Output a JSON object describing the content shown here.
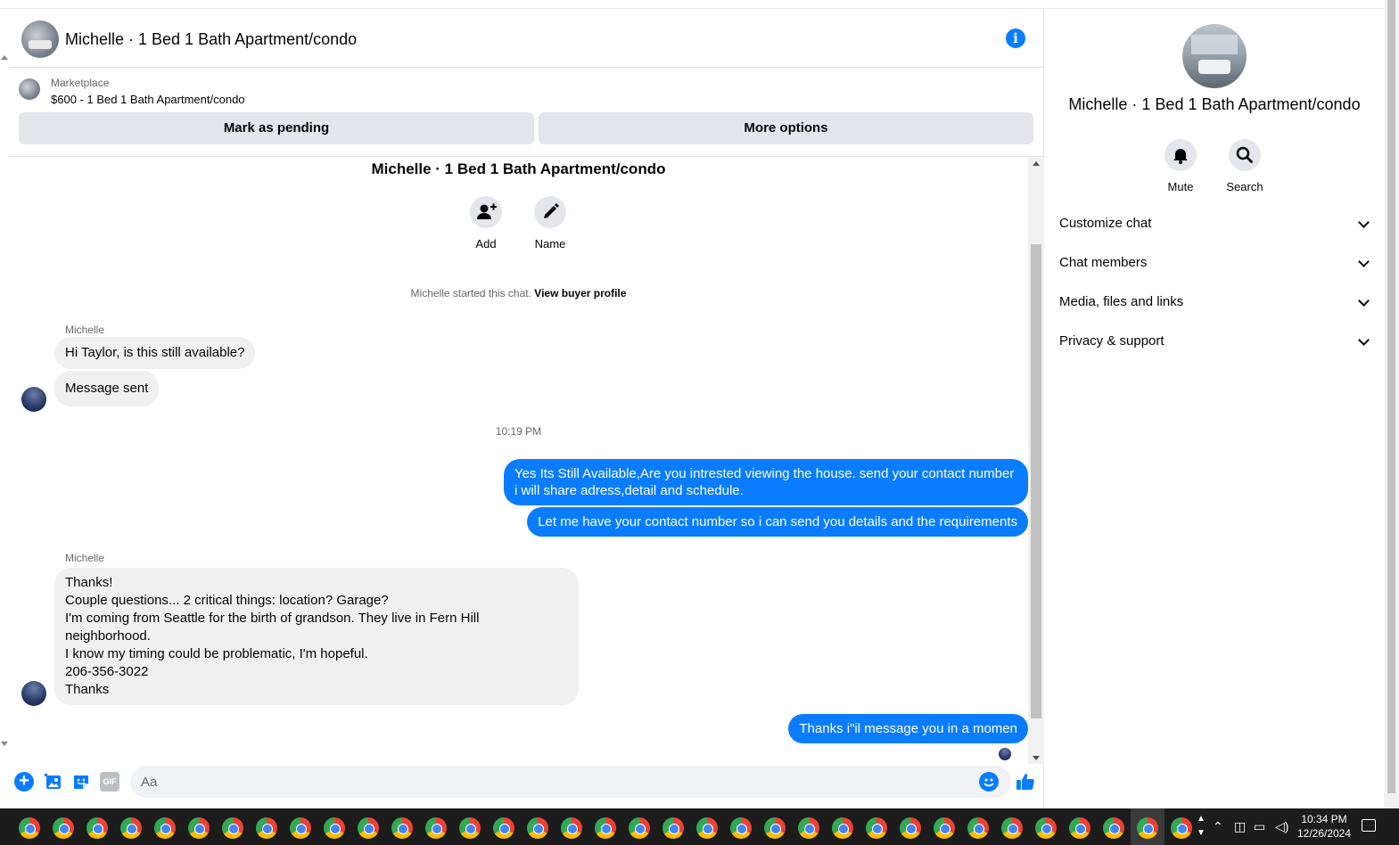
{
  "header": {
    "title": "Michelle · 1 Bed 1 Bath Apartment/condo"
  },
  "marketplace": {
    "label": "Marketplace",
    "listing": "$600 - 1 Bed 1 Bath Apartment/condo",
    "mark_pending": "Mark as pending",
    "more_options": "More options"
  },
  "conversation": {
    "title": "Michelle · 1 Bed 1 Bath Apartment/condo",
    "add_label": "Add",
    "name_label": "Name",
    "started_text": "Michelle started this chat.",
    "view_profile": "View buyer profile",
    "messages": [
      {
        "sender": "Michelle",
        "text": "Hi Taylor, is this still available?"
      },
      {
        "text": "Message sent"
      },
      {
        "timestamp": "10:19 PM"
      },
      {
        "text": "Yes Its Still Available,Are you intrested viewing the house. send your contact number i will share adress,detail and schedule."
      },
      {
        "text": "Let me have your contact number so i can send you details and the requirements"
      },
      {
        "sender": "Michelle",
        "lines": [
          "Thanks!",
          "Couple questions... 2 critical things: location? Garage?",
          "I'm coming from Seattle for the birth of grandson. They live in Fern Hill neighborhood.",
          "I know my timing could be problematic, I'm hopeful.",
          "206-356-3022",
          "Thanks"
        ]
      },
      {
        "text": "Thanks i\"il message you in a momen"
      }
    ]
  },
  "composer": {
    "placeholder": "Aa",
    "gif_label": "GIF"
  },
  "sidebar": {
    "title": "Michelle · 1 Bed 1 Bath Apartment/condo",
    "mute_label": "Mute",
    "search_label": "Search",
    "sections": [
      "Customize chat",
      "Chat members",
      "Media, files and links",
      "Privacy & support"
    ]
  },
  "taskbar": {
    "time": "10:34 PM",
    "date": "12/26/2024"
  },
  "colors": {
    "accent": "#0a7cff",
    "bubble_in": "#f0f0f0",
    "button_bg": "#e4e6eb"
  }
}
